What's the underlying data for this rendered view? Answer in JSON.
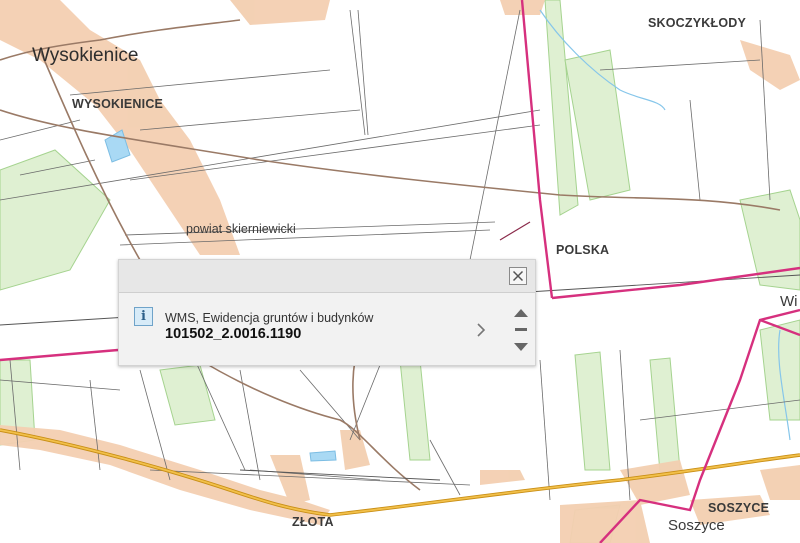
{
  "map": {
    "labels": {
      "wysokienice_town": "Wysokienice",
      "wysokienice_caps": "WYSOKIENICE",
      "skoczykłody": "SKOCZYKŁODY",
      "powiat": "powiat skierniewicki",
      "polska": "POLSKA",
      "wi": "Wi",
      "złota": "ZŁOTA",
      "soszyce_caps": "SOSZYCE",
      "soszyce_town": "Soszyce"
    },
    "colors": {
      "boundary": "#d6307e",
      "road_main": "#e0a020",
      "built_area": "#f1c9a7",
      "forest": "#d9efc9",
      "forest_edge": "#9dcf85",
      "water": "#9fd3f0"
    }
  },
  "popup": {
    "layer_name": "WMS, Ewidencja gruntów i budynków",
    "parcel_id": "101502_2.0016.1190",
    "info_icon": "info-icon",
    "close_icon": "close-icon",
    "next_icon": "chevron-right-icon",
    "scroll_up_icon": "triangle-up-icon",
    "scroll_list_icon": "menu-icon",
    "scroll_down_icon": "triangle-down-icon"
  }
}
